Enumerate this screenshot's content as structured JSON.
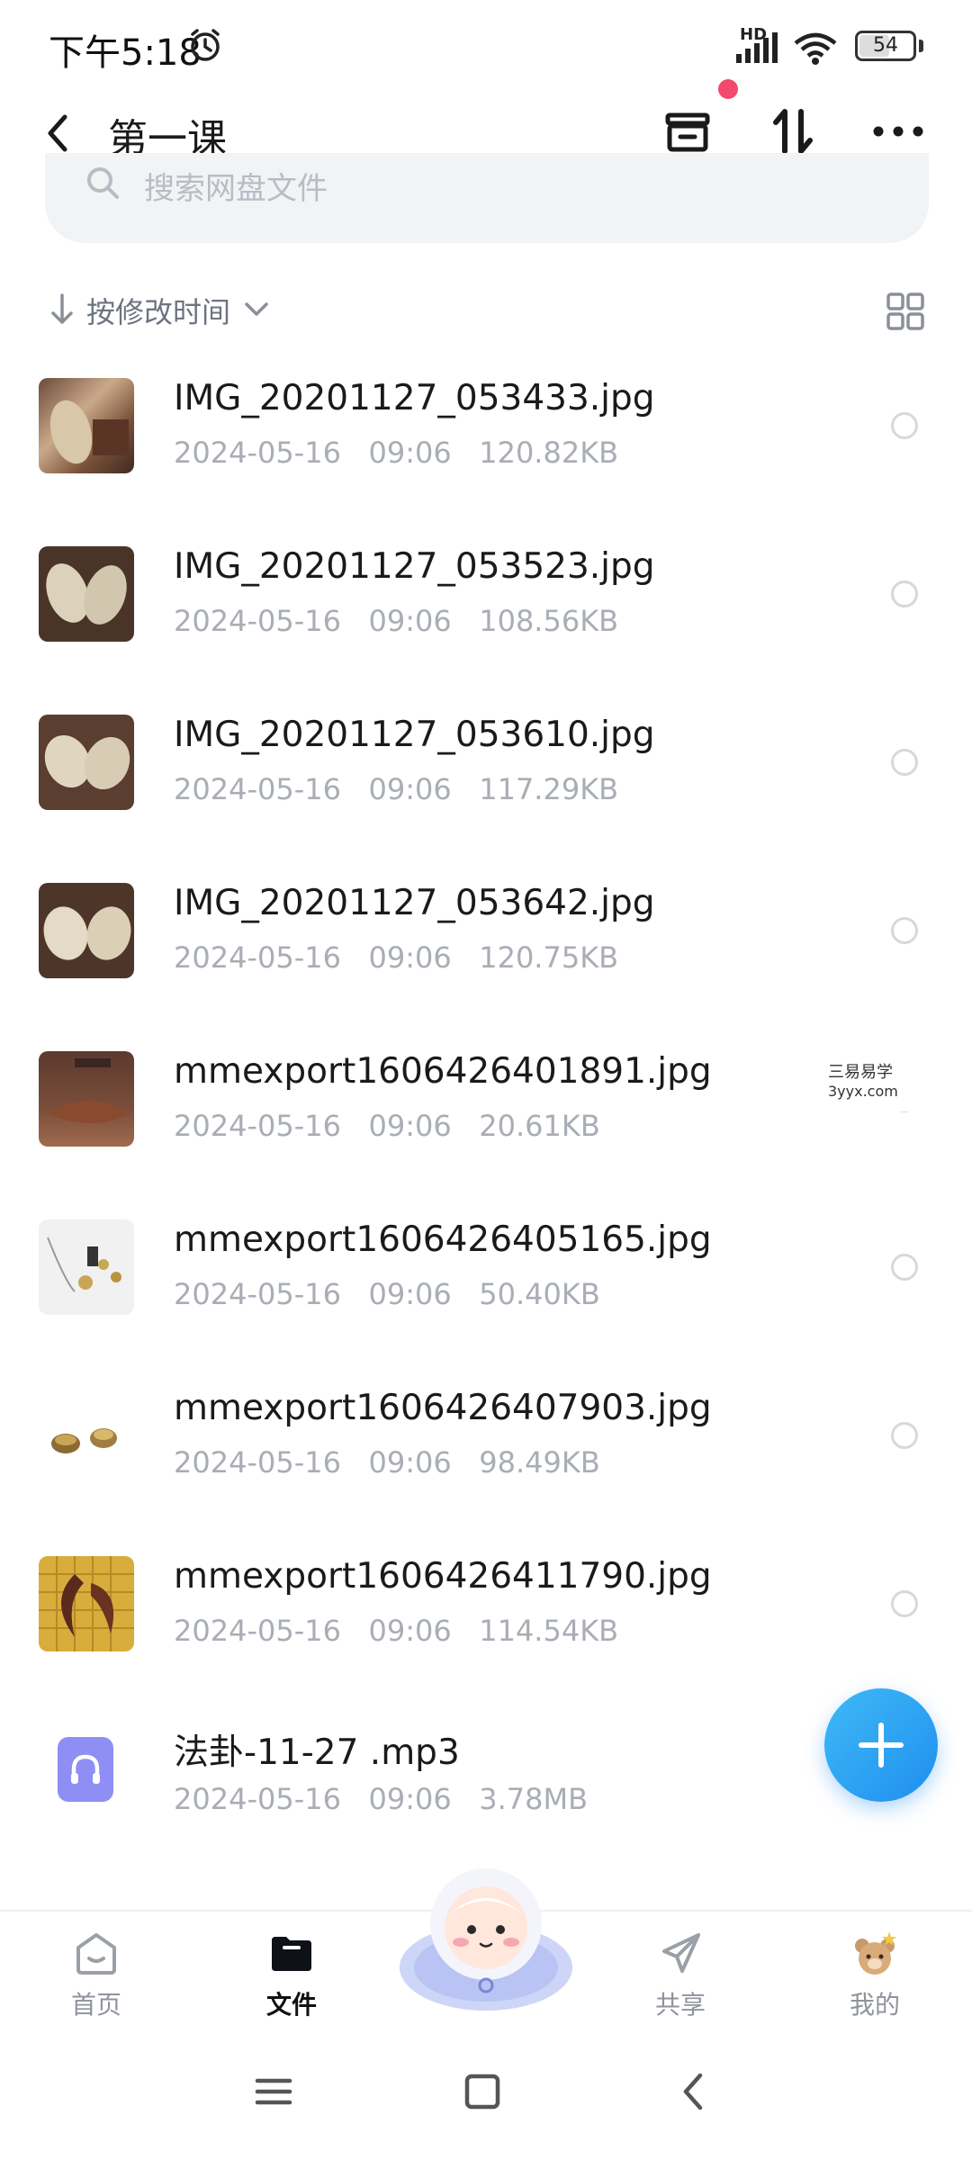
{
  "status_bar": {
    "time": "下午5:18",
    "network_label": "HD",
    "battery": "54",
    "battery_level": 0.54
  },
  "header": {
    "title": "第一课"
  },
  "search": {
    "placeholder": "搜索网盘文件"
  },
  "sort": {
    "label": "按修改时间"
  },
  "files": [
    {
      "name": "IMG_20201127_053433.jpg",
      "date": "2024-05-16",
      "time": "09:06",
      "size": "120.82KB"
    },
    {
      "name": "IMG_20201127_053523.jpg",
      "date": "2024-05-16",
      "time": "09:06",
      "size": "108.56KB"
    },
    {
      "name": "IMG_20201127_053610.jpg",
      "date": "2024-05-16",
      "time": "09:06",
      "size": "117.29KB"
    },
    {
      "name": "IMG_20201127_053642.jpg",
      "date": "2024-05-16",
      "time": "09:06",
      "size": "120.75KB"
    },
    {
      "name": "mmexport1606426401891.jpg",
      "date": "2024-05-16",
      "time": "09:06",
      "size": "20.61KB"
    },
    {
      "name": "mmexport1606426405165.jpg",
      "date": "2024-05-16",
      "time": "09:06",
      "size": "50.40KB"
    },
    {
      "name": "mmexport1606426407903.jpg",
      "date": "2024-05-16",
      "time": "09:06",
      "size": "98.49KB"
    },
    {
      "name": "mmexport1606426411790.jpg",
      "date": "2024-05-16",
      "time": "09:06",
      "size": "114.54KB"
    },
    {
      "name": "法卦-11-27 .mp3",
      "date": "2024-05-16",
      "time": "09:06",
      "size": "3.78MB"
    }
  ],
  "watermark": {
    "line1": "三易易学",
    "line2": "3yyx.com"
  },
  "nav": {
    "home": "首页",
    "files": "文件",
    "share": "共享",
    "mine": "我的"
  },
  "colors": {
    "accent": "#2a9cf2",
    "notify": "#f14a6e",
    "audio_icon": "#8f8ef5"
  }
}
